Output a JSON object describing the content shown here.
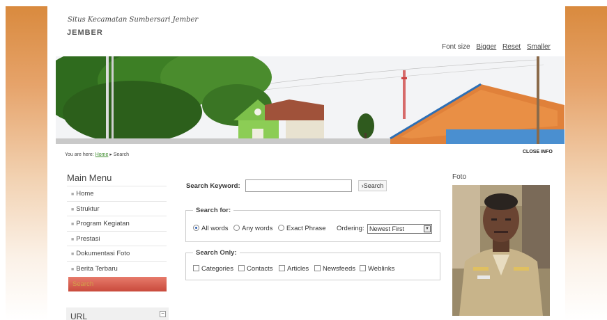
{
  "header": {
    "site_title": "Situs Kecamatan Sumbersari Jember",
    "site_subtitle": "JEMBER"
  },
  "font_size": {
    "label": "Font size",
    "bigger": "Bigger",
    "reset": "Reset",
    "smaller": "Smaller"
  },
  "breadcrumb": {
    "prefix": "You are here:",
    "home": "Home",
    "separator": "▸",
    "current": "Search"
  },
  "close_info": "CLOSE INFO",
  "main_menu": {
    "title": "Main Menu",
    "items": [
      {
        "label": "Home"
      },
      {
        "label": "Struktur"
      },
      {
        "label": "Program Kegiatan"
      },
      {
        "label": "Prestasi"
      },
      {
        "label": "Dokumentasi Foto"
      },
      {
        "label": "Berita Terbaru"
      },
      {
        "label": "Search"
      }
    ]
  },
  "url_box": {
    "title": "URL",
    "toggle": "−"
  },
  "search": {
    "keyword_label": "Search Keyword:",
    "keyword_value": "",
    "button": "›Search",
    "search_for_legend": "Search for:",
    "options": [
      {
        "label": "All words",
        "selected": true
      },
      {
        "label": "Any words",
        "selected": false
      },
      {
        "label": "Exact Phrase",
        "selected": false
      }
    ],
    "ordering_label": "Ordering:",
    "ordering_value": "Newest First",
    "search_only_legend": "Search Only:",
    "areas": [
      {
        "label": "Categories",
        "checked": false
      },
      {
        "label": "Contacts",
        "checked": false
      },
      {
        "label": "Articles",
        "checked": false
      },
      {
        "label": "Newsfeeds",
        "checked": false
      },
      {
        "label": "Weblinks",
        "checked": false
      }
    ]
  },
  "foto": {
    "title": "Foto"
  },
  "colors": {
    "side_band": "#d98a3e",
    "active_menu": "#d2584a",
    "link_green": "#3a8a2a"
  }
}
